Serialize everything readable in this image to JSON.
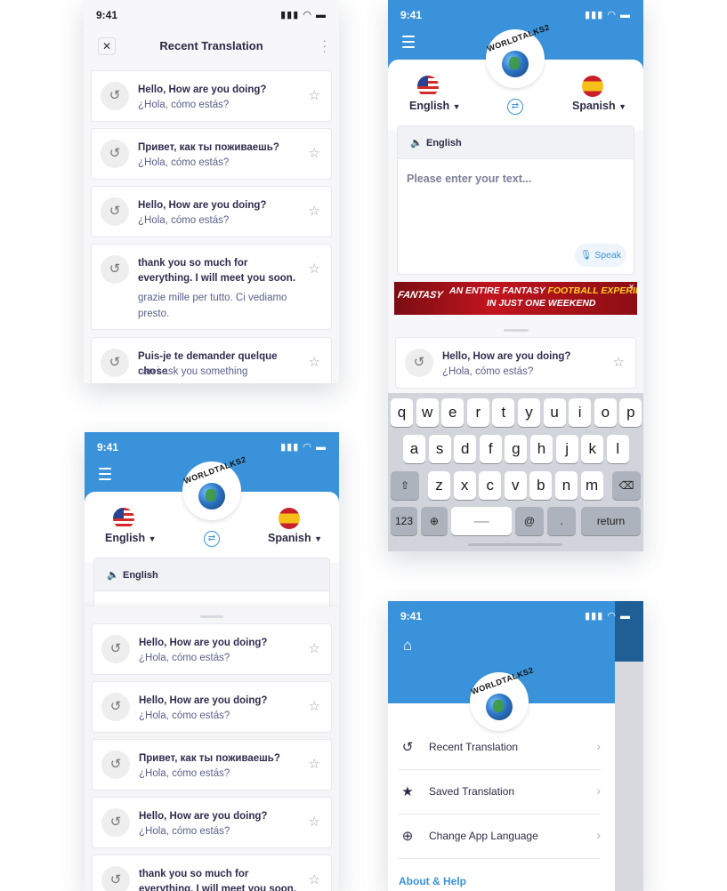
{
  "status": {
    "time": "9:41",
    "icons": "▮▮▮ ◠ ▬"
  },
  "logo_text": "WORLDTALKS2",
  "recent_screen": {
    "title": "Recent Translation",
    "items": [
      {
        "source": "Hello, How are you doing?",
        "target": "¿Hola, cómo estás?"
      },
      {
        "source": "Привет, как ты поживаешь?",
        "target": "¿Hola, cómo estás?"
      },
      {
        "source": "Hello, How are you doing?",
        "target": "¿Hola, cómo estás?"
      },
      {
        "source": "thank you so much for everything. I will meet you soon.",
        "target": "grazie mille per tutto. Ci vediamo presto."
      },
      {
        "source": "Puis-je te demander quelque chose",
        "target": "can i ask you something"
      }
    ]
  },
  "translator_screen": {
    "source_lang": "English",
    "target_lang": "Spanish",
    "input_lang_label": "English",
    "placeholder": "Please enter your text...",
    "speak_label": "Speak",
    "ad": {
      "line1_a": "AN ENTIRE FANTASY ",
      "line1_b": "FOOTBALL EXPERIENCE",
      "line2": "IN JUST ONE WEEKEND",
      "brand": "FANTASY"
    },
    "recent_item": {
      "source": "Hello, How are you doing?",
      "target": "¿Hola, cómo estás?"
    },
    "keyboard": {
      "row1": [
        "q",
        "w",
        "e",
        "r",
        "t",
        "y",
        "u",
        "i",
        "o",
        "p"
      ],
      "row2": [
        "a",
        "s",
        "d",
        "f",
        "g",
        "h",
        "j",
        "k",
        "l"
      ],
      "row3": [
        "z",
        "x",
        "c",
        "v",
        "b",
        "n",
        "m"
      ],
      "num_key": "123",
      "at_key": "@",
      "dot_key": ".",
      "return_key": "return"
    }
  },
  "list_screen": {
    "source_lang": "English",
    "target_lang": "Spanish",
    "input_lang_label": "English",
    "items": [
      {
        "source": "Hello, How are you doing?",
        "target": "¿Hola, cómo estás?"
      },
      {
        "source": "Hello, How are you doing?",
        "target": "¿Hola, cómo estás?"
      },
      {
        "source": "Привет, как ты поживаешь?",
        "target": "¿Hola, cómo estás?"
      },
      {
        "source": "Hello, How are you doing?",
        "target": "¿Hola, cómo estás?"
      },
      {
        "source": "thank you so much for everything. I will meet you soon.",
        "target": ""
      }
    ]
  },
  "drawer_screen": {
    "items": [
      {
        "label": "Recent Translation",
        "icon": "history-icon"
      },
      {
        "label": "Saved Translation",
        "icon": "star-icon"
      },
      {
        "label": "Change App Language",
        "icon": "globe-icon"
      }
    ],
    "section": "About & Help"
  }
}
